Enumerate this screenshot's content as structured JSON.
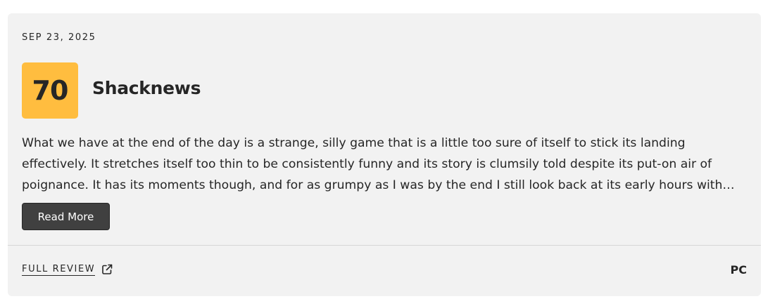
{
  "review": {
    "date": "SEP 23, 2025",
    "score": "70",
    "publication": "Shacknews",
    "quote": "What we have at the end of the day is a strange, silly game that is a little too sure of itself to stick its landing effectively. It stretches itself too thin to be consistently funny and its story is clumsily told despite its put-on air of poignance. It has its moments though, and for as grumpy as I was by the end I still look back at its early hours with…",
    "read_more_label": "Read More",
    "full_review_label": "FULL REVIEW",
    "platform": "PC"
  },
  "icons": {
    "external_link": "external-link-icon"
  },
  "colors": {
    "score_badge": "#ffbd3f",
    "card_background": "#f2f2f2",
    "button_background": "#404040",
    "text": "#262626"
  }
}
